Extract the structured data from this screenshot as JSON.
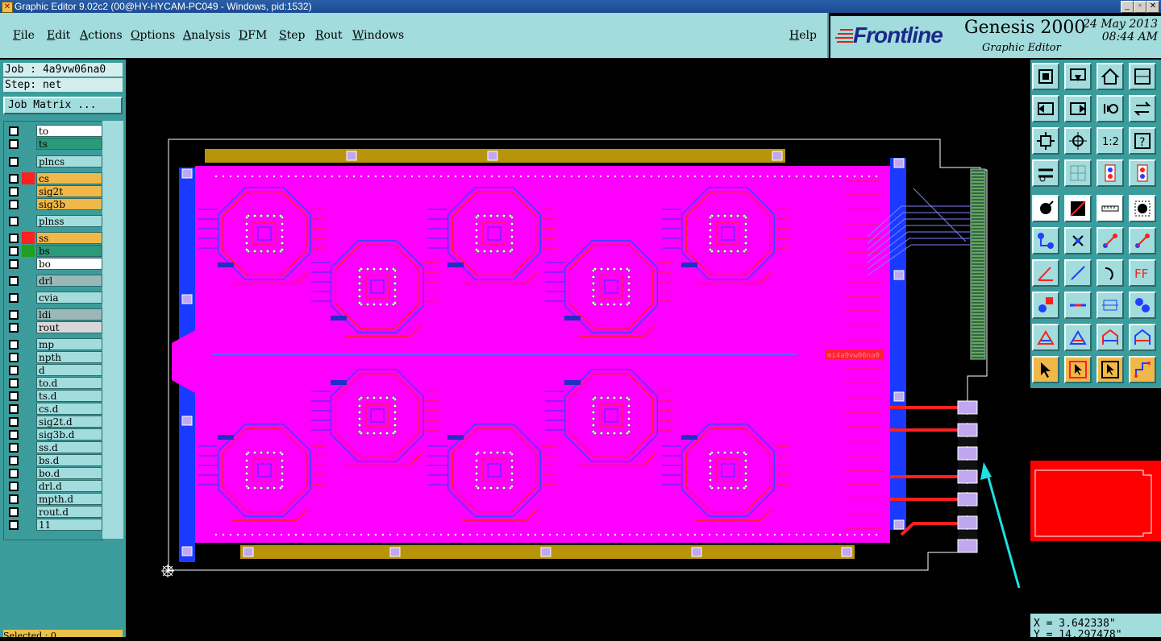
{
  "window": {
    "title": "Graphic Editor 9.02c2 (00@HY-HYCAM-PC049 - Windows, pid:1532)"
  },
  "menu": [
    "File",
    "Edit",
    "Actions",
    "Options",
    "Analysis",
    "DFM",
    "Step",
    "Rout",
    "Windows"
  ],
  "help": "Help",
  "brand": {
    "logo": "Frontline",
    "product": "Genesis 2000",
    "subtitle": "Graphic Editor",
    "date": "24 May 2013",
    "time": "08:44 AM"
  },
  "job": {
    "job_label": "Job : 4a9vw06na0",
    "step_label": "Step: net",
    "matrix_button": "Job Matrix ..."
  },
  "layers": [
    {
      "name": "to",
      "color": "#ffffff"
    },
    {
      "name": "ts",
      "color": "#2a9a7a"
    },
    {
      "name": "plncs",
      "color": "#a2dcdc"
    },
    {
      "name": "cs",
      "color": "#f0b848",
      "swatch": "#ff2020"
    },
    {
      "name": "sig2t",
      "color": "#f0b848"
    },
    {
      "name": "sig3b",
      "color": "#f0b848"
    },
    {
      "name": "plnss",
      "color": "#a2dcdc"
    },
    {
      "name": "ss",
      "color": "#f0b848",
      "swatch": "#ff2020"
    },
    {
      "name": "bs",
      "color": "#2a9a7a",
      "swatch": "#20a020"
    },
    {
      "name": "bo",
      "color": "#ffffff"
    },
    {
      "name": "drl",
      "color": "#9ab8b8"
    },
    {
      "name": "cvia",
      "color": "#a2dcdc"
    },
    {
      "name": "ldi",
      "color": "#9ab8b8"
    },
    {
      "name": "rout",
      "color": "#d8d8d8"
    },
    {
      "name": "mp",
      "color": "#a2dcdc"
    },
    {
      "name": "npth",
      "color": "#a2dcdc"
    },
    {
      "name": "d",
      "color": "#a2dcdc"
    },
    {
      "name": "to.d",
      "color": "#a2dcdc"
    },
    {
      "name": "ts.d",
      "color": "#a2dcdc"
    },
    {
      "name": "cs.d",
      "color": "#a2dcdc"
    },
    {
      "name": "sig2t.d",
      "color": "#a2dcdc"
    },
    {
      "name": "sig3b.d",
      "color": "#a2dcdc"
    },
    {
      "name": "ss.d",
      "color": "#a2dcdc"
    },
    {
      "name": "bs.d",
      "color": "#a2dcdc"
    },
    {
      "name": "bo.d",
      "color": "#a2dcdc"
    },
    {
      "name": "drl.d",
      "color": "#a2dcdc"
    },
    {
      "name": "mpth.d",
      "color": "#a2dcdc"
    },
    {
      "name": "rout.d",
      "color": "#a2dcdc"
    },
    {
      "name": "11",
      "color": "#a2dcdc"
    }
  ],
  "status": {
    "selected": "Selected : 0"
  },
  "coords": {
    "x": "X = 3.642338\"",
    "y": "Y = 14.297478\""
  },
  "board": {
    "label": "mi4a9vw06na0"
  },
  "colors": {
    "panel": "#a2dcdc",
    "board": "#ff00ff",
    "frame_blue": "#1a3aff",
    "rail": "#b8940a",
    "arrow": "#20e0e0"
  }
}
